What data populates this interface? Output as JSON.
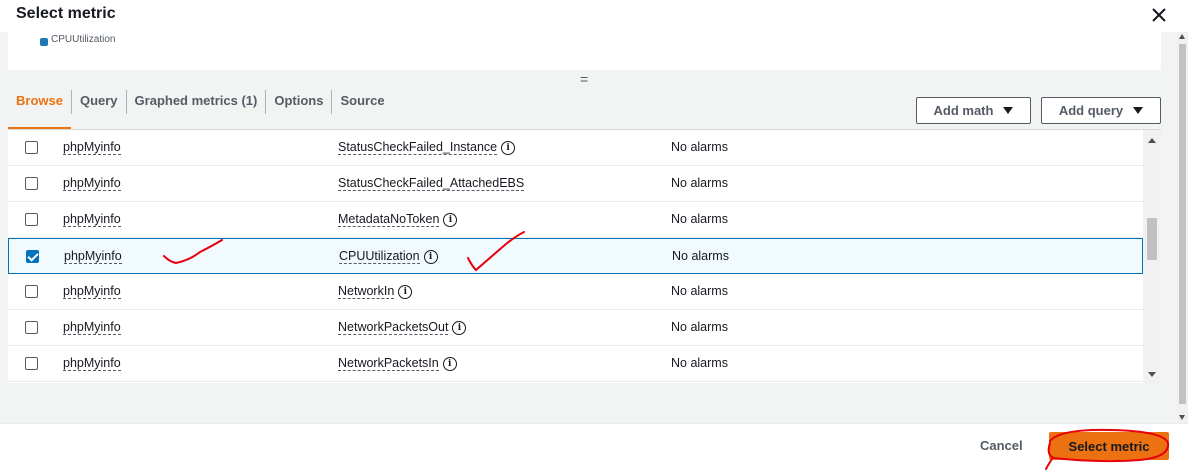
{
  "modal": {
    "title": "Select metric",
    "legend_label": "CPUUtilization",
    "resize_glyph": "="
  },
  "tabs": [
    {
      "label": "Browse",
      "active": true
    },
    {
      "label": "Query"
    },
    {
      "label": "Graphed metrics (1)"
    },
    {
      "label": "Options"
    },
    {
      "label": "Source"
    }
  ],
  "toolbar": {
    "add_math_label": "Add math",
    "add_query_label": "Add query"
  },
  "table": {
    "rows": [
      {
        "checked": false,
        "instance": "phpMyinfo",
        "metric": "StatusCheckFailed_Instance",
        "info": true,
        "alarm": "No alarms"
      },
      {
        "checked": false,
        "instance": "phpMyinfo",
        "metric": "StatusCheckFailed_AttachedEBS",
        "info": false,
        "alarm": "No alarms"
      },
      {
        "checked": false,
        "instance": "phpMyinfo",
        "metric": "MetadataNoToken",
        "info": true,
        "alarm": "No alarms"
      },
      {
        "checked": true,
        "instance": "phpMyinfo",
        "metric": "CPUUtilization",
        "info": true,
        "alarm": "No alarms"
      },
      {
        "checked": false,
        "instance": "phpMyinfo",
        "metric": "NetworkIn",
        "info": true,
        "alarm": "No alarms"
      },
      {
        "checked": false,
        "instance": "phpMyinfo",
        "metric": "NetworkPacketsOut",
        "info": true,
        "alarm": "No alarms"
      },
      {
        "checked": false,
        "instance": "phpMyinfo",
        "metric": "NetworkPacketsIn",
        "info": true,
        "alarm": "No alarms"
      }
    ]
  },
  "footer": {
    "cancel_label": "Cancel",
    "select_label": "Select metric"
  },
  "colors": {
    "accent": "#ec7211",
    "selected_border": "#0073bb",
    "annotation": "#e8000b"
  },
  "icons": {
    "close": "close-icon",
    "info": "info-icon",
    "caret": "caret-down-icon"
  }
}
